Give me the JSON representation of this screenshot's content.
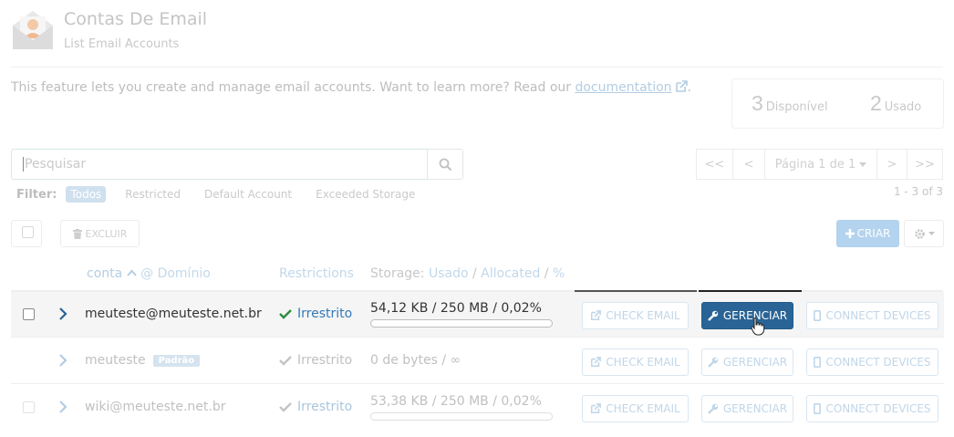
{
  "header": {
    "title": "Contas De Email",
    "subtitle": "List Email Accounts",
    "icon": "email-accounts-icon"
  },
  "intro": {
    "text": "This feature lets you create and manage email accounts. Want to learn more? Read our",
    "link_label": "documentation",
    "suffix": "."
  },
  "stats": {
    "available_count": "3",
    "available_label": "Disponível",
    "used_count": "2",
    "used_label": "Usado"
  },
  "search": {
    "placeholder": "Pesquisar",
    "value": ""
  },
  "pagination": {
    "first": "<<",
    "prev": "<",
    "page_label": "Página 1 de 1",
    "next": ">",
    "last": ">>",
    "range": "1 - 3 of 3"
  },
  "filter": {
    "label": "Filter:",
    "options": [
      "Todos",
      "Restricted",
      "Default Account",
      "Exceeded Storage"
    ],
    "active": "Todos"
  },
  "toolbar": {
    "delete_label": "EXCLUIR",
    "create_label": "CRIAR"
  },
  "table": {
    "columns": {
      "account": "conta",
      "domain": "@ Domínio",
      "restrictions": "Restrictions",
      "storage_prefix": "Storage:",
      "storage_used": "Usado",
      "storage_allocated": "Allocated",
      "storage_percent": "%",
      "separator": "/"
    },
    "rows": [
      {
        "account": "meuteste@meuteste.net.br",
        "badge": "",
        "restriction": "Irrestrito",
        "storage": "54,12 KB / 250 MB / 0,02%",
        "usage_fraction": 0.0002,
        "actions": {
          "check": "CHECK EMAIL",
          "manage": "GERENCIAR",
          "connect": "CONNECT DEVICES"
        }
      },
      {
        "account": "meuteste",
        "badge": "Padrão",
        "restriction": "Irrestrito",
        "storage": "0 de bytes / ∞",
        "usage_fraction": null,
        "actions": {
          "check": "CHECK EMAIL",
          "manage": "GERENCIAR",
          "connect": "CONNECT DEVICES"
        }
      },
      {
        "account": "wiki@meuteste.net.br",
        "badge": "",
        "restriction": "Irrestrito",
        "storage": "53,38 KB / 250 MB / 0,02%",
        "usage_fraction": 0.0002,
        "actions": {
          "check": "CHECK EMAIL",
          "manage": "GERENCIAR",
          "connect": "CONNECT DEVICES"
        }
      }
    ]
  },
  "colors": {
    "primary": "#2a6496",
    "link": "#337ab7",
    "success": "#2e8b3e"
  }
}
